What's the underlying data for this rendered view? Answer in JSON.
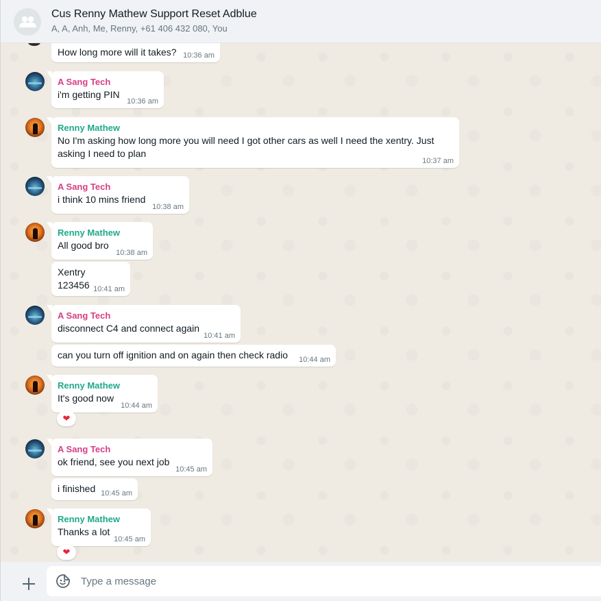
{
  "header": {
    "title": "Cus Renny Mathew Support Reset Adblue",
    "members": "A, A, Anh, Me, Renny, +61 406 432 080, You"
  },
  "messages": [
    {
      "sender": "",
      "text": "How long more will it takes?",
      "time": "10:36 am"
    },
    {
      "sender": "A Sang Tech",
      "text": "i'm getting PIN",
      "time": "10:36 am"
    },
    {
      "sender": "Renny Mathew",
      "text": "No I'm asking how long more you will need I got other cars as well I need the xentry. Just asking I need to plan",
      "time": "10:37 am"
    },
    {
      "sender": "A Sang Tech",
      "text": "i think 10 mins friend",
      "time": "10:38 am"
    },
    {
      "sender": "Renny Mathew",
      "text": "All good bro",
      "time": "10:38 am"
    },
    {
      "sender": "",
      "text_line1": "Xentry",
      "text_line2": "123456",
      "time": "10:41 am"
    },
    {
      "sender": "A Sang Tech",
      "text": "disconnect C4 and connect again",
      "time": "10:41 am"
    },
    {
      "sender": "",
      "text": "can you turn off ignition and on again then check radio",
      "time": "10:44 am"
    },
    {
      "sender": "Renny Mathew",
      "text": "It's good now",
      "time": "10:44 am",
      "reaction": "❤"
    },
    {
      "sender": "A Sang Tech",
      "text": "ok friend, see you next job",
      "time": "10:45 am"
    },
    {
      "sender": "",
      "text": "i finished",
      "time": "10:45 am"
    },
    {
      "sender": "Renny Mathew",
      "text": "Thanks a lot",
      "time": "10:45 am",
      "reaction": "❤"
    }
  ],
  "composer": {
    "placeholder": "Type a message",
    "attach_icon": "plus-icon",
    "emoji_icon": "sticker-smiley-icon"
  },
  "colors": {
    "tech_name": "#d63e85",
    "renny_name": "#1fa88a",
    "background": "#efeae2",
    "bubble": "#ffffff",
    "reaction_heart": "#e8253c"
  }
}
